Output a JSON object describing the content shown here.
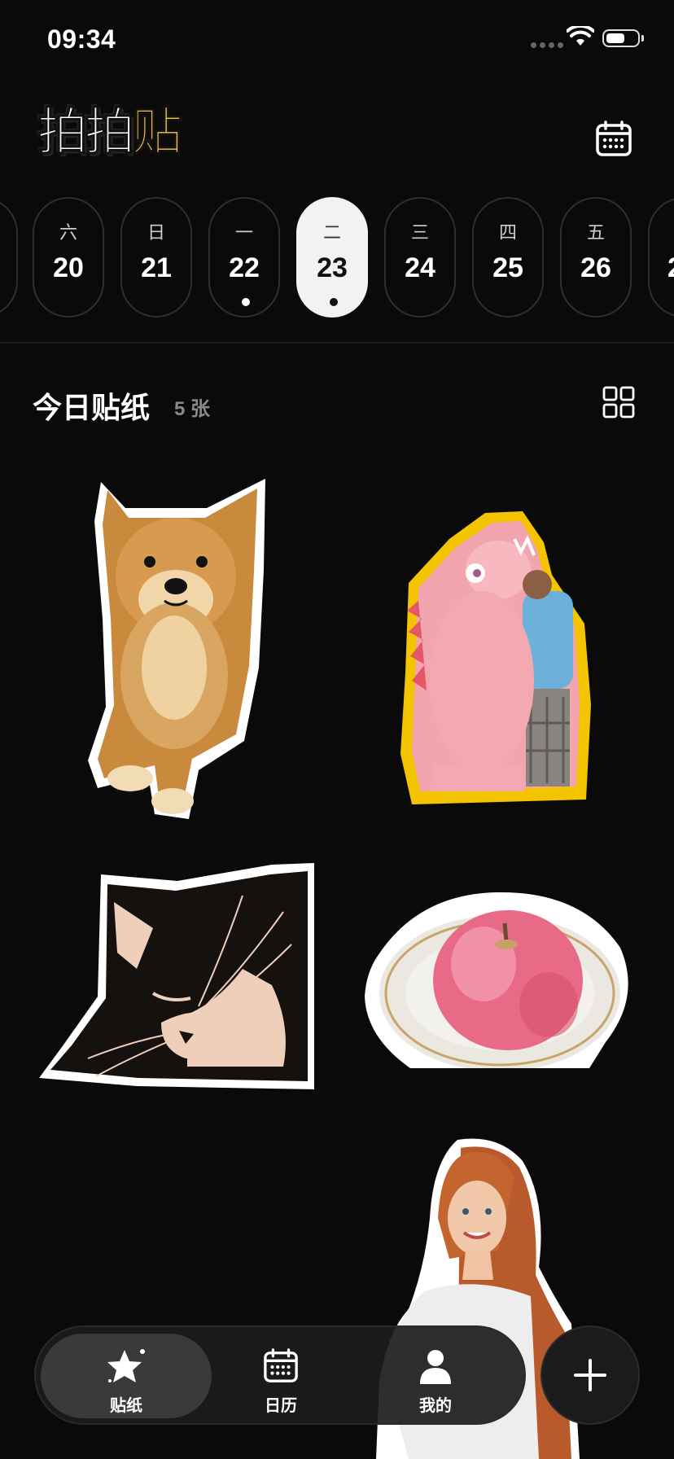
{
  "status_bar": {
    "time": "09:34"
  },
  "header": {
    "logo_part1": "拍拍",
    "logo_part2": "贴",
    "calendar_icon": "calendar-icon"
  },
  "date_strip": {
    "days": [
      {
        "weekday": "",
        "date": ""
      },
      {
        "weekday": "六",
        "date": "20"
      },
      {
        "weekday": "日",
        "date": "21"
      },
      {
        "weekday": "一",
        "date": "22"
      },
      {
        "weekday": "二",
        "date": "23"
      },
      {
        "weekday": "三",
        "date": "24"
      },
      {
        "weekday": "四",
        "date": "25"
      },
      {
        "weekday": "五",
        "date": "26"
      },
      {
        "weekday": "",
        "date": "2"
      }
    ],
    "selected": "23",
    "dots_on": [
      "22",
      "23"
    ]
  },
  "section": {
    "title": "今日贴纸",
    "count": "5 张",
    "layout_icon": "grid-icon"
  },
  "stickers": [
    {
      "subject": "shiba-inu-dog"
    },
    {
      "subject": "pink-dinosaur-hug"
    },
    {
      "subject": "sleeping-black-cat"
    },
    {
      "subject": "apple-on-plate"
    },
    {
      "subject": "red-haired-woman"
    }
  ],
  "tabbar": {
    "tabs": [
      {
        "label": "贴纸",
        "icon": "star-icon",
        "active": true
      },
      {
        "label": "日历",
        "icon": "calendar-icon",
        "active": false
      },
      {
        "label": "我的",
        "icon": "person-icon",
        "active": false
      }
    ],
    "add_icon": "plus-icon"
  },
  "colors": {
    "background": "#0a0a0a",
    "selected_day": "#f2f2f2",
    "logo_accent": "#f6c344",
    "sticker_outline": "#ffffff",
    "dino_outline": "#f5c400"
  }
}
